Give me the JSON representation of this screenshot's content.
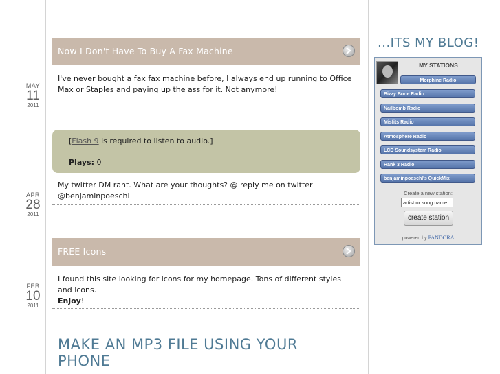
{
  "posts": [
    {
      "title": "Now I Don't Have To Buy A Fax Machine",
      "date": {
        "month": "MAY",
        "day": "11",
        "year": "2011"
      },
      "text": "I've never bought a fax fax machine before, I always end up running to Office Max or Staples and paying up the ass for it. Not anymore!"
    },
    {
      "date": {
        "month": "APR",
        "day": "28",
        "year": "2011"
      },
      "audio": {
        "flash_link": "Flash 9",
        "flash_text": " is required to listen to audio.",
        "plays_label": "Plays:",
        "plays_value": "0"
      },
      "text": "My twitter DM rant. What are your thoughts? @ reply me on twitter @benjaminpoeschl"
    },
    {
      "title": "FREE Icons",
      "date": {
        "month": "FEB",
        "day": "10",
        "year": "2011"
      },
      "text": "I found this site looking for icons for my homepage. Tons of different styles and icons.",
      "emphasis": "Enjoy",
      "emphasis_suffix": "!"
    },
    {
      "title": "MAKE AN MP3 FILE USING YOUR PHONE"
    }
  ],
  "sidebar": {
    "blog_title": "...ITS MY BLOG!",
    "pandora": {
      "heading": "MY STATIONS",
      "stations": [
        "Morphine Radio",
        "Bizzy Bone Radio",
        "Nailbomb Radio",
        "Misfits Radio",
        "Atmosphere Radio",
        "LCD Soundsystem Radio",
        "Hank 3 Radio",
        "benjaminpoeschl's QuickMix"
      ],
      "create_label": "Create a new station:",
      "create_placeholder": "artist or song name",
      "create_button": "create station",
      "powered_by": "powered by",
      "brand": "PANDORA"
    }
  },
  "colors": {
    "post_bar": "#c9b9ab",
    "audio_box": "#c3c4a6",
    "title_accent": "#4f7a94",
    "station_button": "#6383b8"
  },
  "icons": [
    "arrow-right-icon",
    "avatar-photo"
  ]
}
